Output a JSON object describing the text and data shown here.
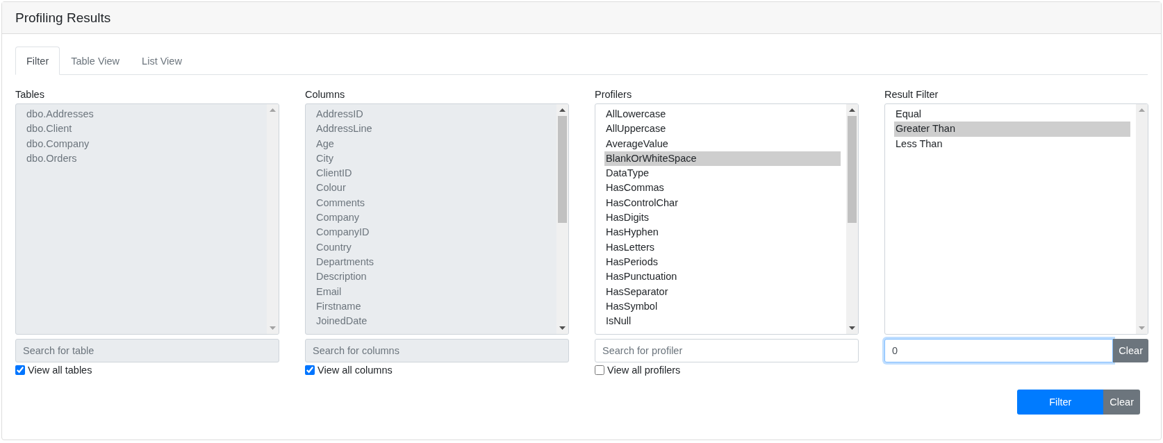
{
  "header": {
    "title": "Profiling Results"
  },
  "tabs": [
    {
      "label": "Filter",
      "selected": true
    },
    {
      "label": "Table View",
      "selected": false
    },
    {
      "label": "List View",
      "selected": false
    }
  ],
  "panels": [
    {
      "label": "Tables",
      "disabled": true,
      "scroll_thumb": false,
      "items": [
        {
          "text": "dbo.Addresses",
          "selected": false
        },
        {
          "text": "dbo.Client",
          "selected": false
        },
        {
          "text": "dbo.Company",
          "selected": false
        },
        {
          "text": "dbo.Orders",
          "selected": false
        }
      ],
      "search": {
        "placeholder": "Search for table"
      },
      "view_all": {
        "label": "View all tables",
        "checked": true
      }
    },
    {
      "label": "Columns",
      "disabled": true,
      "scroll_thumb": true,
      "items": [
        {
          "text": "AddressID",
          "selected": false
        },
        {
          "text": "AddressLine",
          "selected": false
        },
        {
          "text": "Age",
          "selected": false
        },
        {
          "text": "City",
          "selected": false
        },
        {
          "text": "ClientID",
          "selected": false
        },
        {
          "text": "Colour",
          "selected": false
        },
        {
          "text": "Comments",
          "selected": false
        },
        {
          "text": "Company",
          "selected": false
        },
        {
          "text": "CompanyID",
          "selected": false
        },
        {
          "text": "Country",
          "selected": false
        },
        {
          "text": "Departments",
          "selected": false
        },
        {
          "text": "Description",
          "selected": false
        },
        {
          "text": "Email",
          "selected": false
        },
        {
          "text": "Firstname",
          "selected": false
        },
        {
          "text": "JoinedDate",
          "selected": false
        }
      ],
      "search": {
        "placeholder": "Search for columns"
      },
      "view_all": {
        "label": "View all columns",
        "checked": true
      }
    },
    {
      "label": "Profilers",
      "disabled": false,
      "scroll_thumb": true,
      "items": [
        {
          "text": "AllLowercase",
          "selected": false
        },
        {
          "text": "AllUppercase",
          "selected": false
        },
        {
          "text": "AverageValue",
          "selected": false
        },
        {
          "text": "BlankOrWhiteSpace",
          "selected": true
        },
        {
          "text": "DataType",
          "selected": false
        },
        {
          "text": "HasCommas",
          "selected": false
        },
        {
          "text": "HasControlChar",
          "selected": false
        },
        {
          "text": "HasDigits",
          "selected": false
        },
        {
          "text": "HasHyphen",
          "selected": false
        },
        {
          "text": "HasLetters",
          "selected": false
        },
        {
          "text": "HasPeriods",
          "selected": false
        },
        {
          "text": "HasPunctuation",
          "selected": false
        },
        {
          "text": "HasSeparator",
          "selected": false
        },
        {
          "text": "HasSymbol",
          "selected": false
        },
        {
          "text": "IsNull",
          "selected": false
        }
      ],
      "search": {
        "placeholder": "Search for profiler"
      },
      "view_all": {
        "label": "View all profilers",
        "checked": false
      }
    },
    {
      "label": "Result Filter",
      "disabled": false,
      "scroll_thumb": false,
      "items": [
        {
          "text": "Equal",
          "selected": false
        },
        {
          "text": "Greater Than",
          "selected": true
        },
        {
          "text": "Less Than",
          "selected": false
        }
      ],
      "value_field": {
        "value": "0"
      },
      "clear_button": "Clear"
    }
  ],
  "actions": {
    "filter_button": "Filter",
    "clear_button": "Clear"
  }
}
